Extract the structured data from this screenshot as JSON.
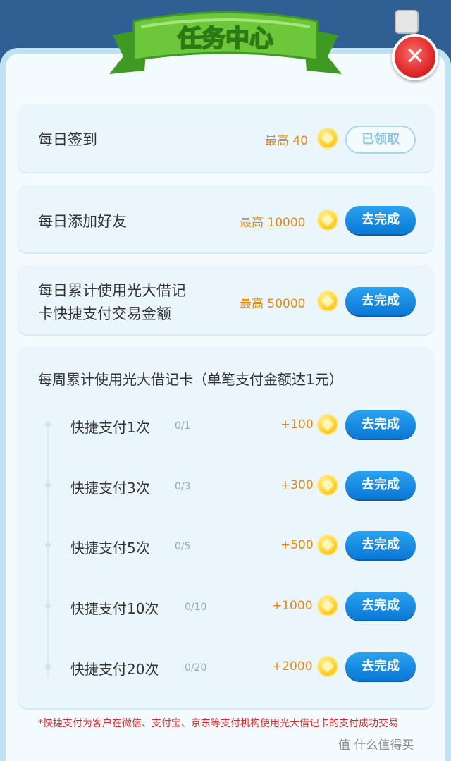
{
  "header": {
    "title": "任务中心",
    "close_symbol": "✕"
  },
  "daily_tasks": [
    {
      "title": "每日签到",
      "reward": "最高 40",
      "button": "已领取",
      "status": "claimed"
    },
    {
      "title": "每日添加好友",
      "reward": "最高 10000",
      "button": "去完成",
      "status": "open"
    },
    {
      "title": [
        "每日累计使用光大借记",
        "卡快捷支付交易金额"
      ],
      "reward": "最高 50000",
      "button": "去完成",
      "status": "open"
    }
  ],
  "weekly": {
    "title": "每周累计使用光大借记卡（单笔支付金额达1元）",
    "tasks": [
      {
        "title": "快捷支付1次",
        "progress": "0/1",
        "reward": "+100",
        "button": "去完成"
      },
      {
        "title": "快捷支付3次",
        "progress": "0/3",
        "reward": "+300",
        "button": "去完成"
      },
      {
        "title": "快捷支付5次",
        "progress": "0/5",
        "reward": "+500",
        "button": "去完成"
      },
      {
        "title": "快捷支付10次",
        "progress": "0/10",
        "reward": "+1000",
        "button": "去完成"
      },
      {
        "title": "快捷支付20次",
        "progress": "0/20",
        "reward": "+2000",
        "button": "去完成"
      }
    ]
  },
  "footnote": "*快捷支付为客户在微信、支付宝、京东等支付机构使用光大借记卡的支付成功交易",
  "watermark": "值 什么值得买",
  "colors": {
    "background": "#2f5f93",
    "accent_blue": "#0a78d6",
    "reward_orange": "#e08a12",
    "banner_green": "#59b82f",
    "close_red": "#d81f1f"
  }
}
